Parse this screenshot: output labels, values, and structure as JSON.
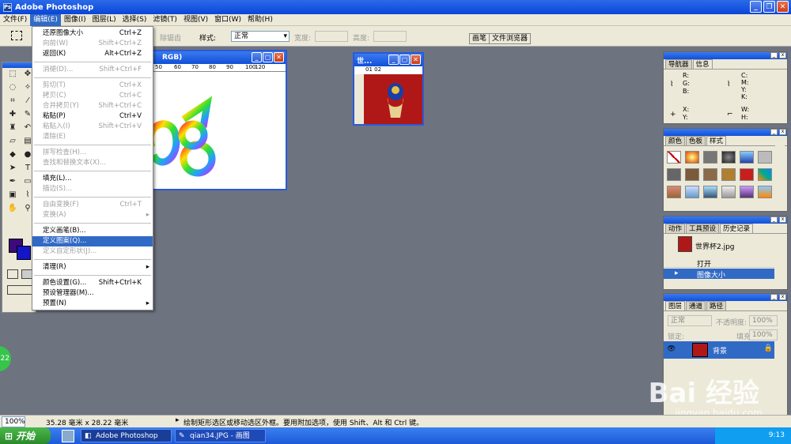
{
  "app": {
    "title": "Adobe Photoshop"
  },
  "menubar": [
    "文件(F)",
    "编辑(E)",
    "图像(I)",
    "图层(L)",
    "选择(S)",
    "滤镜(T)",
    "视图(V)",
    "窗口(W)",
    "帮助(H)"
  ],
  "options": {
    "feather_label": "除锯齿",
    "style_label": "样式:",
    "style_value": "正常",
    "width_label": "宽度:",
    "height_label": "高度:"
  },
  "palette_tabs": [
    "画笔",
    "文件浏览器"
  ],
  "edit_menu": [
    {
      "label": "还原图像大小",
      "shortcut": "Ctrl+Z",
      "state": "normal"
    },
    {
      "label": "向前(W)",
      "shortcut": "Shift+Ctrl+Z",
      "state": "disabled"
    },
    {
      "label": "返回(K)",
      "shortcut": "Alt+Ctrl+Z",
      "state": "normal"
    },
    {
      "label": "消褪(D)...",
      "shortcut": "Shift+Ctrl+F",
      "state": "disabled"
    },
    {
      "label": "剪切(T)",
      "shortcut": "Ctrl+X",
      "state": "disabled"
    },
    {
      "label": "拷贝(C)",
      "shortcut": "Ctrl+C",
      "state": "disabled"
    },
    {
      "label": "合并拷贝(Y)",
      "shortcut": "Shift+Ctrl+C",
      "state": "disabled"
    },
    {
      "label": "粘贴(P)",
      "shortcut": "Ctrl+V",
      "state": "normal"
    },
    {
      "label": "粘贴入(I)",
      "shortcut": "Shift+Ctrl+V",
      "state": "disabled"
    },
    {
      "label": "清除(E)",
      "shortcut": "",
      "state": "disabled"
    },
    {
      "label": "拼写检查(H)...",
      "shortcut": "",
      "state": "disabled"
    },
    {
      "label": "查找和替换文本(X)...",
      "shortcut": "",
      "state": "disabled"
    },
    {
      "label": "填充(L)...",
      "shortcut": "",
      "state": "normal"
    },
    {
      "label": "描边(S)...",
      "shortcut": "",
      "state": "disabled"
    },
    {
      "label": "自由变换(F)",
      "shortcut": "Ctrl+T",
      "state": "disabled"
    },
    {
      "label": "变换(A)",
      "shortcut": "",
      "state": "disabled",
      "submenu": true
    },
    {
      "label": "定义画笔(B)...",
      "shortcut": "",
      "state": "normal"
    },
    {
      "label": "定义图案(Q)...",
      "shortcut": "",
      "state": "selected"
    },
    {
      "label": "定义自定形状(J)...",
      "shortcut": "",
      "state": "disabled"
    },
    {
      "label": "清理(R)",
      "shortcut": "",
      "state": "normal",
      "submenu": true
    },
    {
      "label": "颜色设置(G)...",
      "shortcut": "Shift+Ctrl+K",
      "state": "normal"
    },
    {
      "label": "预设管理器(M)...",
      "shortcut": "",
      "state": "normal"
    },
    {
      "label": "预置(N)",
      "shortcut": "",
      "state": "normal",
      "submenu": true
    }
  ],
  "doc1": {
    "title": "RGB)",
    "ruler": [
      "50",
      "60",
      "70",
      "80",
      "90",
      "100",
      "110",
      "120"
    ]
  },
  "doc2": {
    "title": "世...",
    "ruler": [
      "01",
      "02"
    ]
  },
  "navigator_panel": {
    "tabs": [
      "导航器",
      "信息"
    ],
    "rgb": [
      "R:",
      "G:",
      "B:"
    ],
    "cmyk": [
      "C:",
      "M:",
      "Y:",
      "K:"
    ],
    "xy": [
      "X:",
      "Y:"
    ],
    "wh": [
      "W:",
      "H:"
    ]
  },
  "color_panel": {
    "tabs": [
      "颜色",
      "色板",
      "样式"
    ]
  },
  "history_panel": {
    "tabs": [
      "动作",
      "工具预设",
      "历史记录"
    ],
    "snapshot": "世界杯2.jpg",
    "states": [
      "打开",
      "图像大小"
    ]
  },
  "layers_panel": {
    "tabs": [
      "图层",
      "通道",
      "路径"
    ],
    "mode": "正常",
    "opacity_label": "不透明度:",
    "opacity": "100%",
    "lock_label": "锁定:",
    "fill_label": "填充:",
    "fill": "100%",
    "layer_name": "背景"
  },
  "status": {
    "zoom": "100%",
    "size": "35.28 毫米 x 28.22 毫米",
    "hint": "绘制矩形选区或移动选区外框。要用附加选项，使用 Shift、Alt 和 Ctrl 键。"
  },
  "taskbar": {
    "start": "开始",
    "tasks": [
      "Adobe Photoshop",
      "qian34.JPG - 画图"
    ],
    "time": "9:13"
  },
  "watermark": {
    "brand": "Bai 经验",
    "url": "jingyan.baidu.com"
  },
  "colors": {
    "fg": "#3c0a7a",
    "bg": "#1414c8",
    "highlight": "#316ac5"
  }
}
